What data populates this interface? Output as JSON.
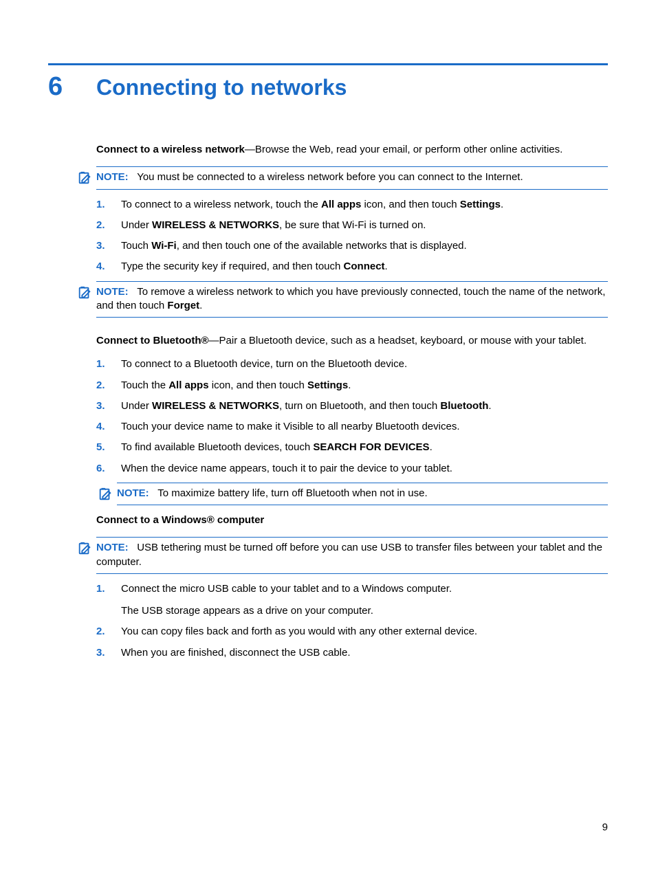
{
  "chapter": {
    "num": "6",
    "title": "Connecting to networks"
  },
  "intro_wifi_bold": "Connect to a wireless network",
  "intro_wifi_rest": "—Browse the Web, read your email, or perform other online activities.",
  "note_label": "NOTE:",
  "note1": "You must be connected to a wireless network before you can connect to the Internet.",
  "wifi_steps": {
    "s1a": "To connect to a wireless network, touch the ",
    "s1b": "All apps",
    "s1c": " icon, and then touch ",
    "s1d": "Settings",
    "s1e": ".",
    "s2a": "Under ",
    "s2b": "WIRELESS & NETWORKS",
    "s2c": ", be sure that Wi-Fi is turned on.",
    "s3a": "Touch ",
    "s3b": "Wi-Fi",
    "s3c": ", and then touch one of the available networks that is displayed.",
    "s4a": "Type the security key if required, and then touch ",
    "s4b": "Connect",
    "s4c": "."
  },
  "note2a": "To remove a wireless network to which you have previously connected, touch the name of the network, and then touch ",
  "note2b": "Forget",
  "note2c": ".",
  "intro_bt_bold": "Connect to Bluetooth®",
  "intro_bt_rest": "—Pair a Bluetooth device, such as a headset, keyboard, or mouse with your tablet.",
  "bt_steps": {
    "s1": "To connect to a Bluetooth device, turn on the Bluetooth device.",
    "s2a": "Touch the ",
    "s2b": "All apps",
    "s2c": " icon, and then touch ",
    "s2d": "Settings",
    "s2e": ".",
    "s3a": "Under ",
    "s3b": "WIRELESS & NETWORKS",
    "s3c": ", turn on Bluetooth, and then touch ",
    "s3d": "Bluetooth",
    "s3e": ".",
    "s4": "Touch your device name to make it Visible to all nearby Bluetooth devices.",
    "s5a": "To find available Bluetooth devices, touch ",
    "s5b": "SEARCH FOR DEVICES",
    "s5c": ".",
    "s6": "When the device name appears, touch it to pair the device to your tablet."
  },
  "note3": "To maximize battery life, turn off Bluetooth when not in use.",
  "win_heading": "Connect to a Windows® computer",
  "note4": "USB tethering must be turned off before you can use USB to transfer files between your tablet and the computer.",
  "win_steps": {
    "s1": "Connect the micro USB cable to your tablet and to a Windows computer.",
    "s1sub": "The USB storage appears as a drive on your computer.",
    "s2": "You can copy files back and forth as you would with any other external device.",
    "s3": "When you are finished, disconnect the USB cable."
  },
  "page_number": "9"
}
